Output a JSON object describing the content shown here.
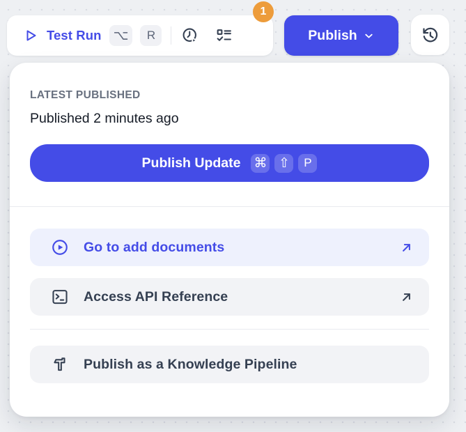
{
  "colors": {
    "accent": "#444CE7",
    "badge_orange": "#ED9C3B",
    "icon_dark": "#354052"
  },
  "toolbar": {
    "test_run_label": "Test Run",
    "shortcuts": [
      "⌥",
      "R"
    ],
    "checklist_badge_count": "1",
    "publish_label": "Publish"
  },
  "panel": {
    "section_label": "LATEST PUBLISHED",
    "status_text": "Published 2 minutes ago",
    "publish_update": {
      "label": "Publish Update",
      "shortcut": [
        "⌘",
        "⇧",
        "P"
      ]
    },
    "menu_items": [
      {
        "label": "Go to add documents",
        "icon": "play-circle-icon",
        "external": true,
        "highlighted": true
      },
      {
        "label": "Access API Reference",
        "icon": "terminal-icon",
        "external": true,
        "highlighted": false
      },
      {
        "label": "Publish as a Knowledge Pipeline",
        "icon": "pipeline-icon",
        "external": false,
        "highlighted": false
      }
    ]
  }
}
